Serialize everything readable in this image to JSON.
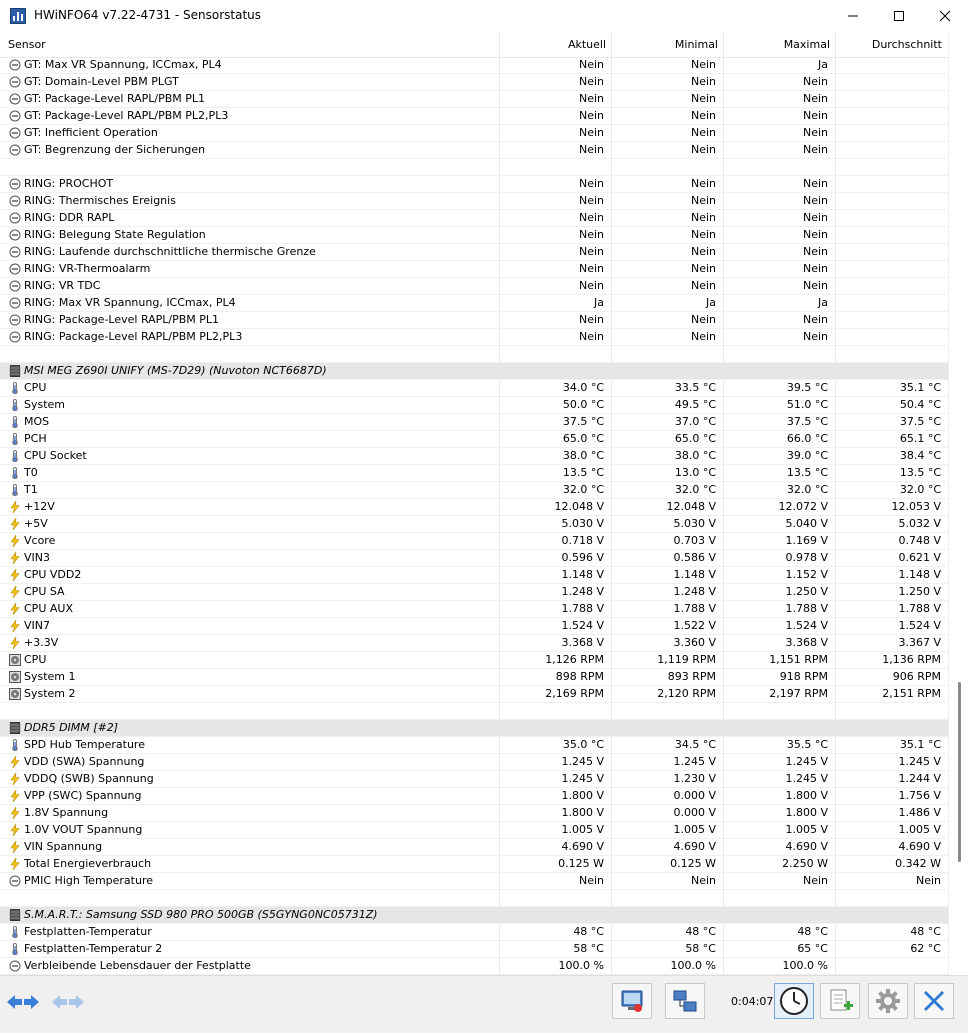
{
  "window": {
    "title": "HWiNFO64 v7.22-4731 - Sensorstatus"
  },
  "header": {
    "sensor": "Sensor",
    "current": "Aktuell",
    "minimum": "Minimal",
    "maximum": "Maximal",
    "average": "Durchschnitt"
  },
  "rows": [
    {
      "t": "state",
      "label": "GT: Max VR Spannung, ICCmax, PL4",
      "v": [
        "Nein",
        "Nein",
        "Ja",
        ""
      ]
    },
    {
      "t": "state",
      "label": "GT: Domain-Level PBM PLGT",
      "v": [
        "Nein",
        "Nein",
        "Nein",
        ""
      ]
    },
    {
      "t": "state",
      "label": "GT: Package-Level RAPL/PBM PL1",
      "v": [
        "Nein",
        "Nein",
        "Nein",
        ""
      ]
    },
    {
      "t": "state",
      "label": "GT: Package-Level RAPL/PBM PL2,PL3",
      "v": [
        "Nein",
        "Nein",
        "Nein",
        ""
      ]
    },
    {
      "t": "state",
      "label": "GT: Inefficient Operation",
      "v": [
        "Nein",
        "Nein",
        "Nein",
        ""
      ]
    },
    {
      "t": "state",
      "label": "GT: Begrenzung der Sicherungen",
      "v": [
        "Nein",
        "Nein",
        "Nein",
        ""
      ]
    },
    {
      "t": "blank"
    },
    {
      "t": "state",
      "label": "RING: PROCHOT",
      "v": [
        "Nein",
        "Nein",
        "Nein",
        ""
      ]
    },
    {
      "t": "state",
      "label": "RING: Thermisches Ereignis",
      "v": [
        "Nein",
        "Nein",
        "Nein",
        ""
      ]
    },
    {
      "t": "state",
      "label": "RING: DDR RAPL",
      "v": [
        "Nein",
        "Nein",
        "Nein",
        ""
      ]
    },
    {
      "t": "state",
      "label": "RING: Belegung State Regulation",
      "v": [
        "Nein",
        "Nein",
        "Nein",
        ""
      ]
    },
    {
      "t": "state",
      "label": "RING: Laufende durchschnittliche thermische Grenze",
      "v": [
        "Nein",
        "Nein",
        "Nein",
        ""
      ]
    },
    {
      "t": "state",
      "label": "RING: VR-Thermoalarm",
      "v": [
        "Nein",
        "Nein",
        "Nein",
        ""
      ]
    },
    {
      "t": "state",
      "label": "RING: VR TDC",
      "v": [
        "Nein",
        "Nein",
        "Nein",
        ""
      ]
    },
    {
      "t": "state",
      "label": "RING: Max VR Spannung, ICCmax, PL4",
      "v": [
        "Ja",
        "Ja",
        "Ja",
        ""
      ]
    },
    {
      "t": "state",
      "label": "RING: Package-Level RAPL/PBM PL1",
      "v": [
        "Nein",
        "Nein",
        "Nein",
        ""
      ]
    },
    {
      "t": "state",
      "label": "RING: Package-Level RAPL/PBM PL2,PL3",
      "v": [
        "Nein",
        "Nein",
        "Nein",
        ""
      ]
    },
    {
      "t": "blank"
    },
    {
      "t": "group",
      "label": "MSI MEG Z690I UNIFY (MS-7D29) (Nuvoton NCT6687D)"
    },
    {
      "t": "temp",
      "label": "CPU",
      "v": [
        "34.0 °C",
        "33.5 °C",
        "39.5 °C",
        "35.1 °C"
      ]
    },
    {
      "t": "temp",
      "label": "System",
      "v": [
        "50.0 °C",
        "49.5 °C",
        "51.0 °C",
        "50.4 °C"
      ]
    },
    {
      "t": "temp",
      "label": "MOS",
      "v": [
        "37.5 °C",
        "37.0 °C",
        "37.5 °C",
        "37.5 °C"
      ]
    },
    {
      "t": "temp",
      "label": "PCH",
      "v": [
        "65.0 °C",
        "65.0 °C",
        "66.0 °C",
        "65.1 °C"
      ]
    },
    {
      "t": "temp",
      "label": "CPU Socket",
      "v": [
        "38.0 °C",
        "38.0 °C",
        "39.0 °C",
        "38.4 °C"
      ]
    },
    {
      "t": "temp",
      "label": "T0",
      "v": [
        "13.5 °C",
        "13.0 °C",
        "13.5 °C",
        "13.5 °C"
      ]
    },
    {
      "t": "temp",
      "label": "T1",
      "v": [
        "32.0 °C",
        "32.0 °C",
        "32.0 °C",
        "32.0 °C"
      ]
    },
    {
      "t": "volt",
      "label": "+12V",
      "v": [
        "12.048 V",
        "12.048 V",
        "12.072 V",
        "12.053 V"
      ]
    },
    {
      "t": "volt",
      "label": "+5V",
      "v": [
        "5.030 V",
        "5.030 V",
        "5.040 V",
        "5.032 V"
      ]
    },
    {
      "t": "volt",
      "label": "Vcore",
      "v": [
        "0.718 V",
        "0.703 V",
        "1.169 V",
        "0.748 V"
      ]
    },
    {
      "t": "volt",
      "label": "VIN3",
      "v": [
        "0.596 V",
        "0.586 V",
        "0.978 V",
        "0.621 V"
      ]
    },
    {
      "t": "volt",
      "label": "CPU VDD2",
      "v": [
        "1.148 V",
        "1.148 V",
        "1.152 V",
        "1.148 V"
      ]
    },
    {
      "t": "volt",
      "label": "CPU SA",
      "v": [
        "1.248 V",
        "1.248 V",
        "1.250 V",
        "1.250 V"
      ]
    },
    {
      "t": "volt",
      "label": "CPU AUX",
      "v": [
        "1.788 V",
        "1.788 V",
        "1.788 V",
        "1.788 V"
      ]
    },
    {
      "t": "volt",
      "label": "VIN7",
      "v": [
        "1.524 V",
        "1.522 V",
        "1.524 V",
        "1.524 V"
      ]
    },
    {
      "t": "volt",
      "label": "+3.3V",
      "v": [
        "3.368 V",
        "3.360 V",
        "3.368 V",
        "3.367 V"
      ]
    },
    {
      "t": "fan",
      "label": "CPU",
      "v": [
        "1,126 RPM",
        "1,119 RPM",
        "1,151 RPM",
        "1,136 RPM"
      ]
    },
    {
      "t": "fan",
      "label": "System 1",
      "v": [
        "898 RPM",
        "893 RPM",
        "918 RPM",
        "906 RPM"
      ]
    },
    {
      "t": "fan",
      "label": "System 2",
      "v": [
        "2,169 RPM",
        "2,120 RPM",
        "2,197 RPM",
        "2,151 RPM"
      ]
    },
    {
      "t": "blank"
    },
    {
      "t": "group",
      "label": "DDR5 DIMM [#2]"
    },
    {
      "t": "temp",
      "label": "SPD Hub Temperature",
      "v": [
        "35.0 °C",
        "34.5 °C",
        "35.5 °C",
        "35.1 °C"
      ]
    },
    {
      "t": "volt",
      "label": "VDD (SWA) Spannung",
      "v": [
        "1.245 V",
        "1.245 V",
        "1.245 V",
        "1.245 V"
      ]
    },
    {
      "t": "volt",
      "label": "VDDQ (SWB) Spannung",
      "v": [
        "1.245 V",
        "1.230 V",
        "1.245 V",
        "1.244 V"
      ]
    },
    {
      "t": "volt",
      "label": "VPP (SWC) Spannung",
      "v": [
        "1.800 V",
        "0.000 V",
        "1.800 V",
        "1.756 V"
      ]
    },
    {
      "t": "volt",
      "label": "1.8V Spannung",
      "v": [
        "1.800 V",
        "0.000 V",
        "1.800 V",
        "1.486 V"
      ]
    },
    {
      "t": "volt",
      "label": "1.0V VOUT Spannung",
      "v": [
        "1.005 V",
        "1.005 V",
        "1.005 V",
        "1.005 V"
      ]
    },
    {
      "t": "volt",
      "label": "VIN Spannung",
      "v": [
        "4.690 V",
        "4.690 V",
        "4.690 V",
        "4.690 V"
      ]
    },
    {
      "t": "volt",
      "label": "Total Energieverbrauch",
      "v": [
        "0.125 W",
        "0.125 W",
        "2.250 W",
        "0.342 W"
      ]
    },
    {
      "t": "state",
      "label": "PMIC High Temperature",
      "v": [
        "Nein",
        "Nein",
        "Nein",
        "Nein"
      ]
    },
    {
      "t": "blank"
    },
    {
      "t": "group",
      "label": "S.M.A.R.T.: Samsung SSD 980 PRO 500GB (S5GYNG0NC05731Z)"
    },
    {
      "t": "temp",
      "label": "Festplatten-Temperatur",
      "v": [
        "48 °C",
        "48 °C",
        "48 °C",
        "48 °C"
      ]
    },
    {
      "t": "temp",
      "label": "Festplatten-Temperatur 2",
      "v": [
        "58 °C",
        "58 °C",
        "65 °C",
        "62 °C"
      ]
    },
    {
      "t": "state",
      "label": "Verbleibende Lebensdauer der Festplatte",
      "v": [
        "100.0 %",
        "100.0 %",
        "100.0 %",
        ""
      ]
    }
  ],
  "footer": {
    "elapsed": "0:04:07"
  }
}
